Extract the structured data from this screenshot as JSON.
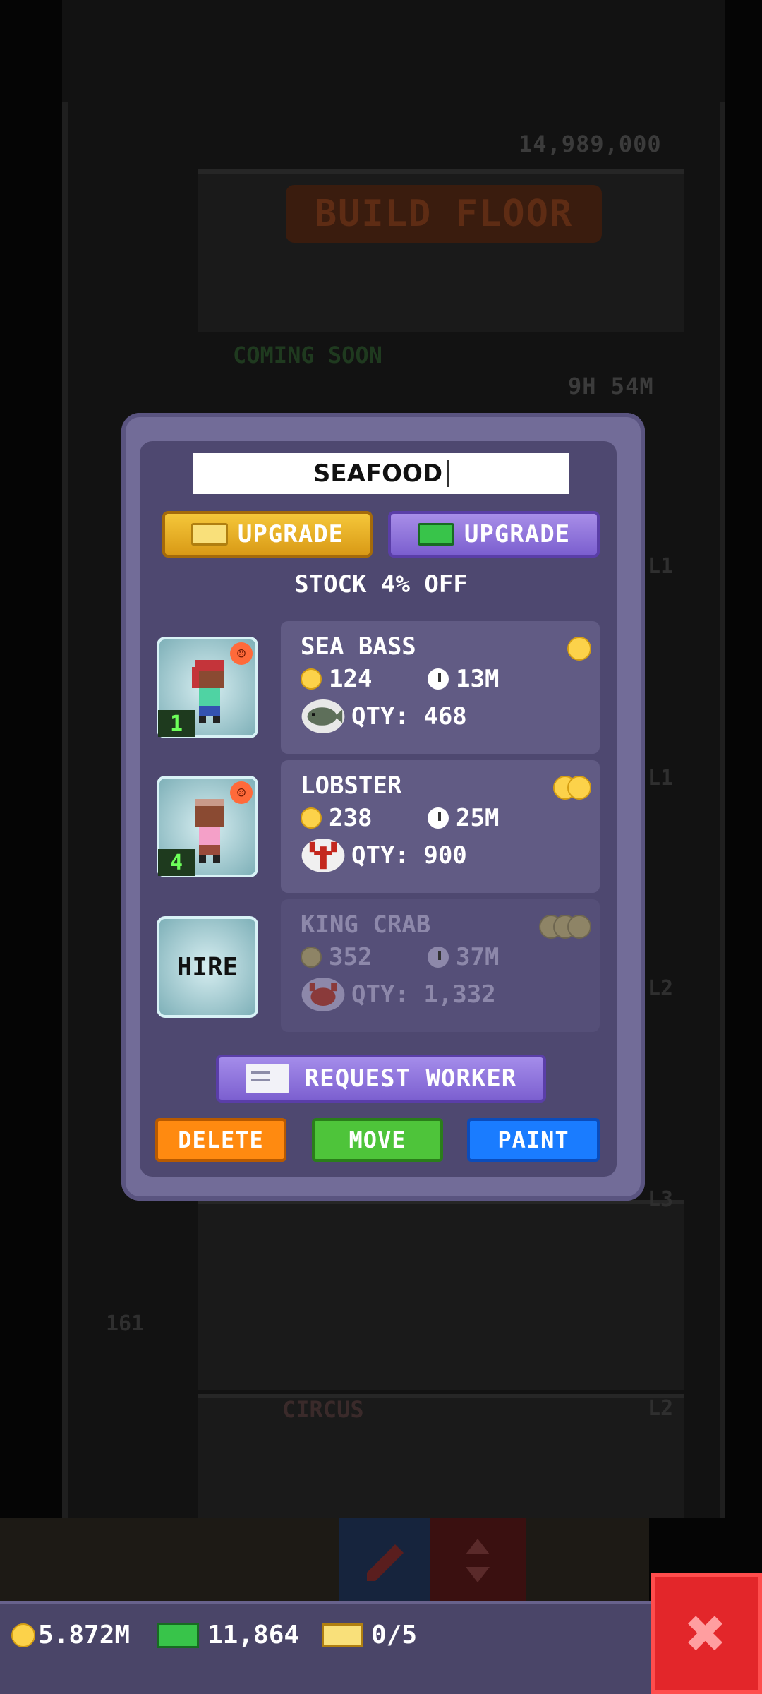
{
  "background": {
    "top_counter": "14,989,000",
    "build_floor_label": "BUILD FLOOR",
    "coming_soon_label": "COMING SOON",
    "timer": "9H 54M",
    "level_labels": [
      "L1",
      "L1",
      "L2",
      "L3",
      "L2"
    ],
    "floor_number": "161",
    "circus_label": "CIRCUS"
  },
  "modal": {
    "floor_name": "SEAFOOD",
    "upgrade_gold_label": "UPGRADE",
    "upgrade_cash_label": "UPGRADE",
    "discount_text": "STOCK 4% OFF",
    "items": [
      {
        "name": "SEA BASS",
        "price": "124",
        "time": "13M",
        "qty_label": "QTY: 468",
        "worker_level": "1",
        "stars": 1,
        "icon": "fish-icon",
        "locked": false
      },
      {
        "name": "LOBSTER",
        "price": "238",
        "time": "25M",
        "qty_label": "QTY: 900",
        "worker_level": "4",
        "stars": 2,
        "icon": "lobster-icon",
        "locked": false
      },
      {
        "name": "KING CRAB",
        "price": "352",
        "time": "37M",
        "qty_label": "QTY: 1,332",
        "stars": 3,
        "icon": "crab-icon",
        "locked": true
      }
    ],
    "hire_label": "HIRE",
    "request_worker_label": "REQUEST WORKER",
    "delete_label": "DELETE",
    "move_label": "MOVE",
    "paint_label": "PAINT"
  },
  "status": {
    "coins": "5.872M",
    "cash": "11,864",
    "bux": "0/5"
  },
  "colors": {
    "modal_bg": "#4e4870",
    "gold": "#fcd24a",
    "delete": "#ff8a10",
    "move": "#4ec43a",
    "paint": "#1a7cff",
    "close": "#e3262a"
  }
}
